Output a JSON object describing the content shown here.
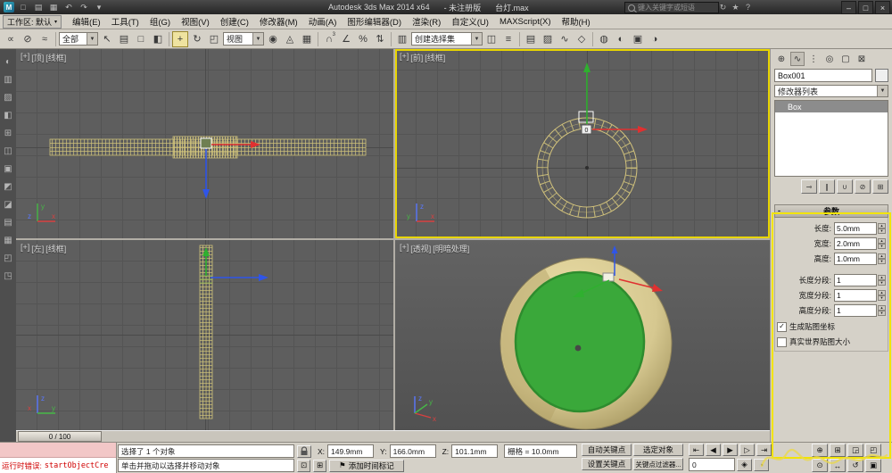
{
  "titlebar": {
    "product": "Autodesk 3ds Max  2014 x64",
    "license": "- 未注册版",
    "filename": "台灯.max",
    "search_placeholder": "键入关键字或短语",
    "minimize": "–",
    "maximize": "□",
    "close": "×"
  },
  "menubar": {
    "workspace": "工作区: 默认",
    "items": [
      "编辑(E)",
      "工具(T)",
      "组(G)",
      "视图(V)",
      "创建(C)",
      "修改器(M)",
      "动画(A)",
      "图形编辑器(D)",
      "渲染(R)",
      "自定义(U)",
      "MAXScript(X)",
      "帮助(H)"
    ]
  },
  "toolbar": {
    "selection_filter": "全部",
    "reference_coord": "视图",
    "named_selection_placeholder": "创建选择集"
  },
  "viewports": {
    "top_left": {
      "plus": "[+]",
      "view": "[顶]",
      "shading": "[线框]"
    },
    "top_right": {
      "plus": "[+]",
      "view": "[前]",
      "shading": "[线框]",
      "gizmo_label": "0"
    },
    "bottom_left": {
      "plus": "[+]",
      "view": "[左]",
      "shading": "[线框]"
    },
    "bottom_right": {
      "plus": "[+]",
      "view": "[透视]",
      "shading": "[明暗处理]"
    },
    "axis": {
      "x": "x",
      "y": "y",
      "z": "z"
    }
  },
  "command_panel": {
    "object_name": "Box001",
    "modifier_list_label": "修改器列表",
    "stack": [
      "Box"
    ],
    "rollout_title": "参数",
    "params": [
      {
        "label": "长度:",
        "value": "5.0mm"
      },
      {
        "label": "宽度:",
        "value": "2.0mm"
      },
      {
        "label": "高度:",
        "value": "1.0mm"
      },
      {
        "label": "长度分段:",
        "value": "1"
      },
      {
        "label": "宽度分段:",
        "value": "1"
      },
      {
        "label": "高度分段:",
        "value": "1"
      }
    ],
    "checkboxes": [
      {
        "label": "生成贴图坐标",
        "checked": true
      },
      {
        "label": "真实世界贴图大小",
        "checked": false
      }
    ]
  },
  "timeline": {
    "slider_label": "0 / 100"
  },
  "statusbar": {
    "listener_error_label": "运行时错误:",
    "listener_error_value": "startObjectCre",
    "selection_status": "选择了 1 个对象",
    "prompt": "单击并拖动以选择并移动对象",
    "x_label": "X:",
    "x_value": "149.9mm",
    "y_label": "Y:",
    "y_value": "166.0mm",
    "z_label": "Z:",
    "z_value": "101.1mm",
    "grid_label": "栅格 = 10.0mm",
    "auto_key": "自动关键点",
    "selected_mode": "选定对象",
    "set_key": "设置关键点",
    "key_filters": "关键点过滤器...",
    "add_time_tag": "添加时间标记",
    "frame": "0"
  },
  "colors": {
    "active_viewport_border": "#e8d500",
    "annotation": "#f2e400",
    "wireframe": "#cfc27a",
    "object_green": "#3aa83a",
    "object_tan": "#d9cd98"
  }
}
